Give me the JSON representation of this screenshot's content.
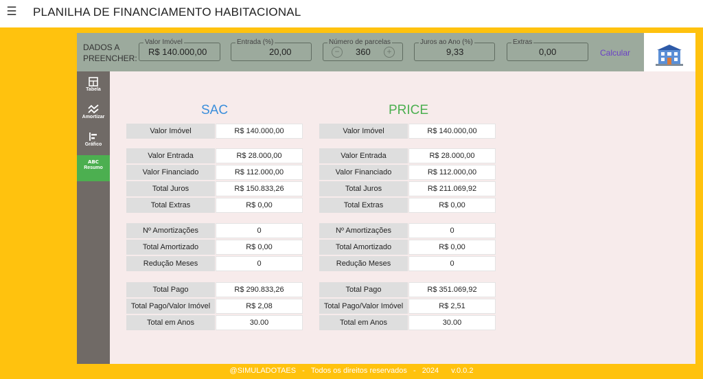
{
  "header": {
    "title": "PLANILHA DE FINANCIAMENTO HABITACIONAL",
    "menu_icon": "hamburger-icon"
  },
  "inputs": {
    "label": [
      "DADOS A",
      "PREENCHER:"
    ],
    "valor_imovel": {
      "label": "Valor Imóvel",
      "value": "R$ 140.000,00"
    },
    "entrada": {
      "label": "Entrada (%)",
      "value": "20,00"
    },
    "parcelas": {
      "label": "Número de parcelas",
      "value": "360",
      "minus": "−",
      "plus": "+"
    },
    "juros": {
      "label": "Juros ao Ano (%)",
      "value": "9,33"
    },
    "extras": {
      "label": "Extras",
      "value": "0,00"
    },
    "calcular": "Calcular"
  },
  "sidebar": {
    "items": [
      {
        "label": "Tabela",
        "icon": "table-icon"
      },
      {
        "label": "Amortizar",
        "icon": "amortize-icon"
      },
      {
        "label": "Gráfico",
        "icon": "chart-icon"
      },
      {
        "label": "Resumo",
        "icon": "abc-icon",
        "active": true
      }
    ]
  },
  "sac": {
    "title": "SAC",
    "rows": [
      [
        "Valor Imóvel",
        "R$ 140.000,00"
      ],
      [
        "Valor Entrada",
        "R$ 28.000,00"
      ],
      [
        "Valor Financiado",
        "R$ 112.000,00"
      ],
      [
        "Total Juros",
        "R$ 150.833,26"
      ],
      [
        "Total Extras",
        "R$ 0,00"
      ],
      [
        "Nº Amortizações",
        "0"
      ],
      [
        "Total Amortizado",
        "R$ 0,00"
      ],
      [
        "Redução Meses",
        "0"
      ],
      [
        "Total Pago",
        "R$ 290.833,26"
      ],
      [
        "Total Pago/Valor Imóvel",
        "R$ 2,08"
      ],
      [
        "Total em Anos",
        "30.00"
      ]
    ]
  },
  "price": {
    "title": "PRICE",
    "rows": [
      [
        "Valor Imóvel",
        "R$ 140.000,00"
      ],
      [
        "Valor Entrada",
        "R$ 28.000,00"
      ],
      [
        "Valor Financiado",
        "R$ 112.000,00"
      ],
      [
        "Total Juros",
        "R$ 211.069,92"
      ],
      [
        "Total Extras",
        "R$ 0,00"
      ],
      [
        "Nº Amortizações",
        "0"
      ],
      [
        "Total Amortizado",
        "R$ 0,00"
      ],
      [
        "Redução Meses",
        "0"
      ],
      [
        "Total Pago",
        "R$ 351.069,92"
      ],
      [
        "Total Pago/Valor Imóvel",
        "R$ 2,51"
      ],
      [
        "Total em Anos",
        "30.00"
      ]
    ]
  },
  "footer": {
    "credit": "@SIMULADOTAES",
    "sep": "-",
    "rights": "Todos os direitos reservados",
    "year": "2024",
    "version": "v.0.0.2"
  },
  "colors": {
    "background": "#ffc20e",
    "sac": "#3a8edb",
    "price": "#4caf50",
    "sidebar": "#706a66",
    "active": "#4caf50",
    "calc": "#6a3fc7"
  }
}
